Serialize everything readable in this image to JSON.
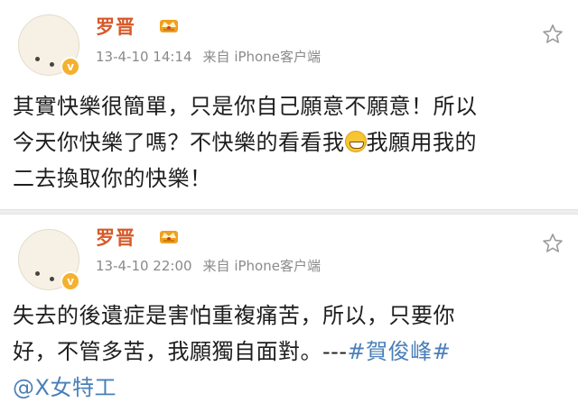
{
  "posts": [
    {
      "author": "罗晋",
      "timestamp": "13-4-10 14:14",
      "source": "来自 iPhone客户端",
      "lines": [
        "其實快樂很簡單，只是你自己願意不願意！所以",
        "今天你快樂了嗎？不快樂的看看我",
        "我願用我的",
        "二去換取你的快樂！"
      ]
    },
    {
      "author": "罗晋",
      "timestamp": "13-4-10 22:00",
      "source": "来自 iPhone客户端",
      "lines": [
        "失去的後遺症是害怕重複痛苦，所以，只要你",
        "好，不管多苦，我願獨自面對。---"
      ],
      "hashtag": "#賀俊峰#",
      "mention": "@X女特工"
    }
  ],
  "colors": {
    "author": "#d65a2a",
    "meta": "#8a8a8a",
    "link": "#4a7fb8",
    "verified_badge": "#f5b12e"
  },
  "icons": {
    "verified": "verified-badge-icon",
    "crown": "crown-icon",
    "favorite": "star-icon",
    "emoji": "grin-emoji-icon"
  }
}
